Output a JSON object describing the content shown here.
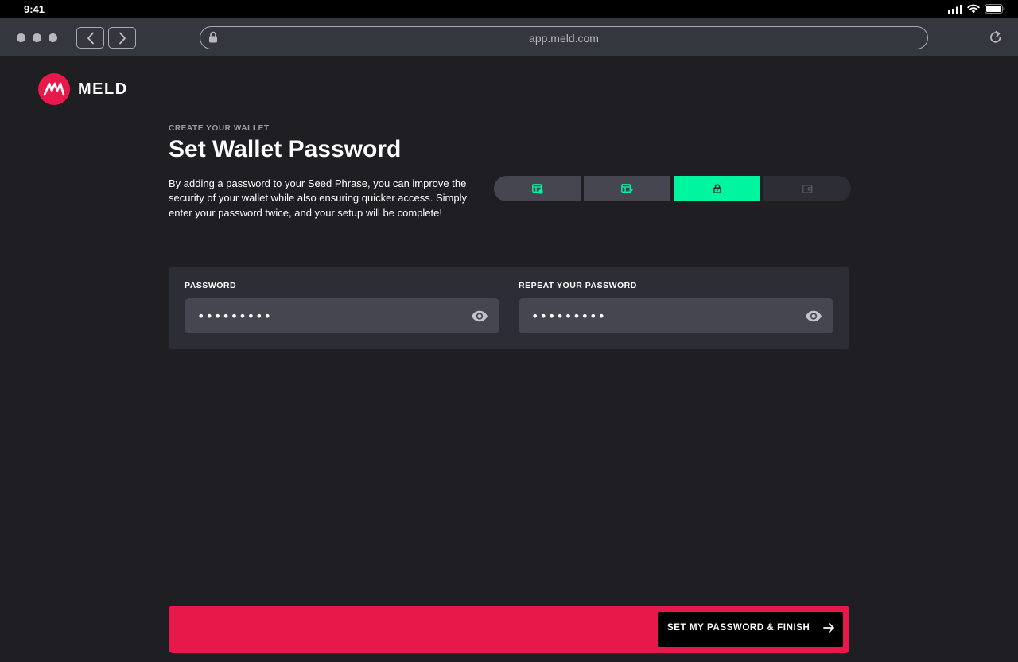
{
  "status_bar": {
    "time": "9:41"
  },
  "browser": {
    "url": "app.meld.com"
  },
  "brand": {
    "name": "MELD",
    "color": "#e8194a"
  },
  "header": {
    "eyebrow": "CREATE YOUR WALLET",
    "title": "Set Wallet Password",
    "description": "By adding a password to your Seed Phrase, you can improve the security of your wallet while also ensuring quicker access. Simply enter your password twice, and your setup will be complete!"
  },
  "stepper": {
    "accent": "#00f5a0",
    "current_step": 3,
    "total_steps": 4,
    "steps": [
      {
        "icon": "seed-table-icon",
        "state": "done"
      },
      {
        "icon": "table-check-icon",
        "state": "done"
      },
      {
        "icon": "lock-icon",
        "state": "active"
      },
      {
        "icon": "wallet-icon",
        "state": "pending"
      }
    ]
  },
  "form": {
    "password": {
      "label": "PASSWORD",
      "value": "•••••••••",
      "icon": "eye-icon"
    },
    "repeat_password": {
      "label": "REPEAT YOUR PASSWORD",
      "value": "•••••••••",
      "icon": "eye-icon"
    }
  },
  "footer": {
    "finish_label": "SET MY PASSWORD & FINISH",
    "finish_icon": "arrow-right-icon"
  }
}
